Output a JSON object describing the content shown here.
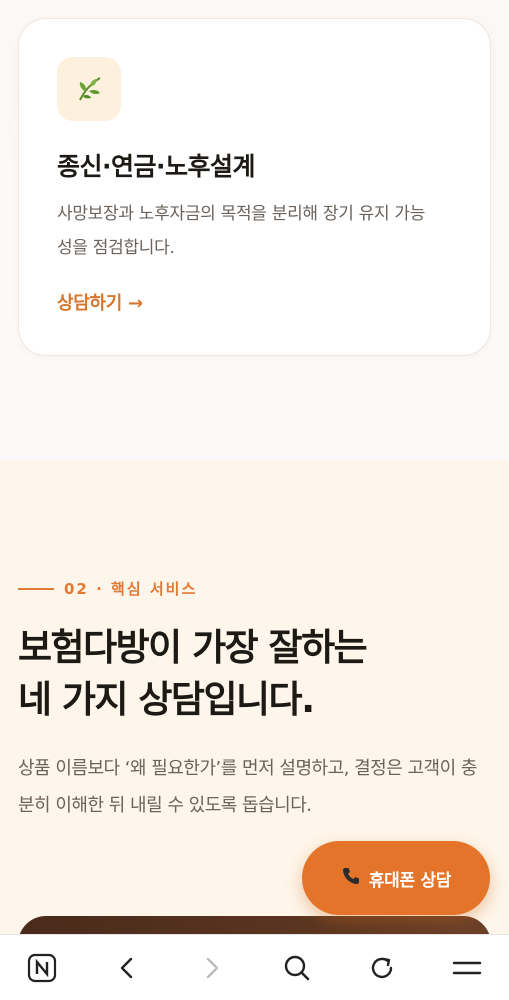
{
  "card": {
    "icon": "herb-leaf-icon",
    "title": "종신·연금·노후설계",
    "description": "사망보장과 노후자금의 목적을 분리해 장기 유지 가능성을 점검합니다.",
    "link_label": "상담하기 →"
  },
  "section": {
    "eyebrow": "02 · 핵심 서비스",
    "headline_line1": "보험다방이 가장 잘하는",
    "headline_line2": "네 가지 상담입니다.",
    "description": "상품 이름보다 ‘왜 필요한가’를 먼저 설명하고, 결정은 고객이 충분히 이해한 뒤 내릴 수 있도록 돕습니다."
  },
  "fab": {
    "label": "휴대폰 상담",
    "icon": "phone-icon"
  },
  "browser_nav": {
    "items": [
      "naver-home-icon",
      "back-icon",
      "forward-icon",
      "search-icon",
      "refresh-icon",
      "menu-icon"
    ]
  },
  "colors": {
    "accent": "#e5742b",
    "link": "#d8772c",
    "section_bg": "#fef6ea"
  }
}
